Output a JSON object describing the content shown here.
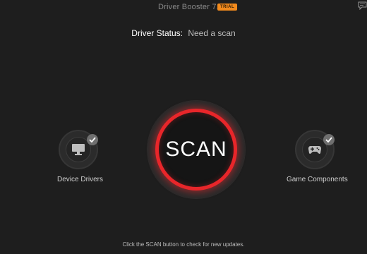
{
  "app": {
    "title": "Driver Booster 7.6",
    "badge": "TRIAL"
  },
  "header": {
    "feedback_icon": "feedback-icon"
  },
  "status": {
    "label": "Driver Status:",
    "value": "Need a scan"
  },
  "scan": {
    "label": "SCAN",
    "accent": "#e8262a"
  },
  "features": {
    "device_drivers": {
      "label": "Device Drivers",
      "icon": "monitor-icon",
      "checked": true
    },
    "game_components": {
      "label": "Game Components",
      "icon": "gamepad-icon",
      "checked": true
    }
  },
  "footer": {
    "hint": "Click the SCAN button to check for new updates."
  },
  "colors": {
    "background": "#1e1e1e",
    "badge": "#f28a1c",
    "ring": "#e8262a"
  }
}
